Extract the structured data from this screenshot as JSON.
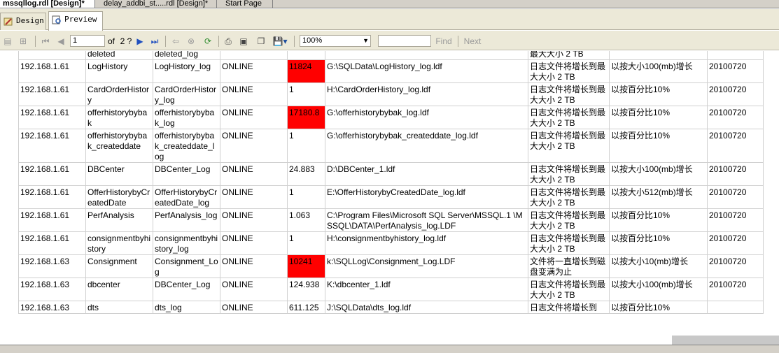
{
  "doc_tabs": [
    "mssqllog.rdl [Design]*",
    "delay_addbi_st.....rdl [Design]*",
    "Start Page"
  ],
  "view_tabs": {
    "design": "Design",
    "preview": "Preview"
  },
  "toolbar": {
    "page": "1",
    "of_label": "of",
    "total": "2 ?",
    "zoom": "100%",
    "find": "Find",
    "next": "Next"
  },
  "top_partial": [
    "deleted",
    "deleted_log",
    "最大大小 2 TB"
  ],
  "rows": [
    {
      "ip": "192.168.1.61",
      "db": "LogHistory",
      "logical": "LogHistory_log",
      "state": "ONLINE",
      "size": "11824",
      "alert": true,
      "path": "G:\\SQLData\\LogHistory_log.ldf",
      "growth_desc": "日志文件将增长到最大大小 2 TB",
      "growth_rule": "以按大小100(mb)增长",
      "date": "20100720"
    },
    {
      "ip": "192.168.1.61",
      "db": "CardOrderHistory",
      "logical": "CardOrderHistory_log",
      "state": "ONLINE",
      "size": "1",
      "alert": false,
      "path": "H:\\CardOrderHistory_log.ldf",
      "growth_desc": "日志文件将增长到最大大小 2 TB",
      "growth_rule": "以按百分比10%",
      "date": "20100720"
    },
    {
      "ip": "192.168.1.61",
      "db": "offerhistorybybak",
      "logical": "offerhistorybybak_log",
      "state": "ONLINE",
      "size": "17180.8",
      "alert": true,
      "path": "G:\\offerhistorybybak_log.ldf",
      "growth_desc": "日志文件将增长到最大大小 2 TB",
      "growth_rule": "以按百分比10%",
      "date": "20100720"
    },
    {
      "ip": "192.168.1.61",
      "db": "offerhistorybybak_createddate",
      "logical": "offerhistorybybak_createddate_log",
      "state": "ONLINE",
      "size": "1",
      "alert": false,
      "path": "G:\\offerhistorybybak_createddate_log.ldf",
      "growth_desc": "日志文件将增长到最大大小 2 TB",
      "growth_rule": "以按百分比10%",
      "date": "20100720"
    },
    {
      "ip": "192.168.1.61",
      "db": "DBCenter",
      "logical": "DBCenter_Log",
      "state": "ONLINE",
      "size": "24.883",
      "alert": false,
      "path": "D:\\DBCenter_1.ldf",
      "growth_desc": "日志文件将增长到最大大小 2 TB",
      "growth_rule": "以按大小100(mb)增长",
      "date": "20100720"
    },
    {
      "ip": "192.168.1.61",
      "db": "OfferHistorybyCreatedDate",
      "logical": "OfferHistorybyCreatedDate_log",
      "state": "ONLINE",
      "size": "1",
      "alert": false,
      "path": "E:\\OfferHistorybyCreatedDate_log.ldf",
      "growth_desc": "日志文件将增长到最大大小 2 TB",
      "growth_rule": "以按大小512(mb)增长",
      "date": "20100720"
    },
    {
      "ip": "192.168.1.61",
      "db": "PerfAnalysis",
      "logical": "PerfAnalysis_log",
      "state": "ONLINE",
      "size": "1.063",
      "alert": false,
      "path": "C:\\Program Files\\Microsoft SQL Server\\MSSQL.1 \\MSSQL\\DATA\\PerfAnalysis_log.LDF",
      "growth_desc": "日志文件将增长到最大大小 2 TB",
      "growth_rule": "以按百分比10%",
      "date": "20100720"
    },
    {
      "ip": "192.168.1.61",
      "db": "consignmentbyhistory",
      "logical": "consignmentbyhistory_log",
      "state": "ONLINE",
      "size": "1",
      "alert": false,
      "path": "H:\\consignmentbyhistory_log.ldf",
      "growth_desc": "日志文件将增长到最大大小 2 TB",
      "growth_rule": "以按百分比10%",
      "date": "20100720"
    },
    {
      "ip": "192.168.1.63",
      "db": "Consignment",
      "logical": "Consignment_Log",
      "state": "ONLINE",
      "size": "10241",
      "alert": true,
      "path": "k:\\SQLLog\\Consignment_Log.LDF",
      "growth_desc": "文件将一直增长到磁盘变满为止",
      "growth_rule": "以按大小10(mb)增长",
      "date": "20100720"
    },
    {
      "ip": "192.168.1.63",
      "db": "dbcenter",
      "logical": "DBCenter_Log",
      "state": "ONLINE",
      "size": "124.938",
      "alert": false,
      "path": "K:\\dbcenter_1.ldf",
      "growth_desc": "日志文件将增长到最大大小 2 TB",
      "growth_rule": "以按大小100(mb)增长",
      "date": "20100720"
    },
    {
      "ip": "192.168.1.63",
      "db": "dts",
      "logical": "dts_log",
      "state": "ONLINE",
      "size": "611.125",
      "alert": false,
      "path": "J:\\SQLData\\dts_log.ldf",
      "growth_desc": "日志文件将增长到",
      "growth_rule": "以按百分比10%",
      "date": ""
    }
  ]
}
